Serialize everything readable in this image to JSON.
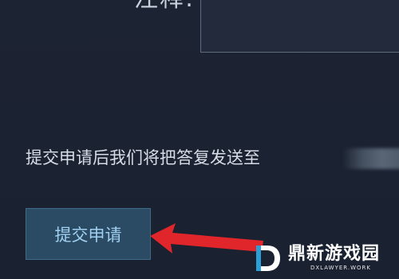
{
  "form": {
    "note_label": "注释:",
    "info_text": "提交申请后我们将把答复发送至",
    "submit_label": "提交申请"
  },
  "watermark": {
    "title": "鼎新游戏园",
    "subtitle": "DXLAWYER.WORK"
  },
  "colors": {
    "background": "#1b2130",
    "button_bg": "#2b4a63",
    "button_text": "#9fd0f0",
    "arrow": "#e0262a"
  },
  "icons": {
    "arrow": "red-arrow-icon",
    "logo": "d-logo-icon"
  }
}
